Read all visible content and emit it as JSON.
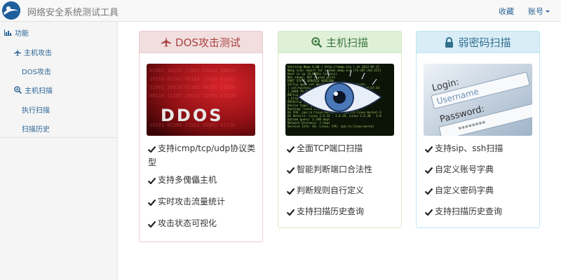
{
  "navbar": {
    "brand_title": "网络安全系统测试工具",
    "favorites": "收藏",
    "account": "账号"
  },
  "sidebar": {
    "header": "功能",
    "items": [
      {
        "label": "主机攻击",
        "icon": "plane-icon"
      },
      {
        "label": "DOS攻击"
      },
      {
        "label": "主机扫描",
        "icon": "zoom-in-icon"
      },
      {
        "label": "执行扫描"
      },
      {
        "label": "扫描历史"
      }
    ]
  },
  "cards": [
    {
      "title": "DOS攻击测试",
      "icon": "plane-icon",
      "image_text": "DDOS",
      "features": [
        "支持icmp/tcp/udp协议类型",
        "支持多傀儡主机",
        "实时攻击流量统计",
        "攻击状态可视化"
      ]
    },
    {
      "title": "主机扫描",
      "icon": "zoom-in-icon",
      "features": [
        "全面TCP端口扫描",
        "智能判断端口合法性",
        "判断规则自行定义",
        "支持扫描历史查询"
      ]
    },
    {
      "title": "弱密码扫描",
      "icon": "lock-icon",
      "image_text": [
        "Login:",
        "Username",
        "Password:",
        "********"
      ],
      "features": [
        "支持sip、ssh扫描",
        "自定义账号字典",
        "自定义密码字典",
        "支持扫描历史查询"
      ]
    }
  ],
  "colors": {
    "link": "#2a6496",
    "danger_bg": "#f2dede",
    "danger_text": "#a94442",
    "success_bg": "#dff0d8",
    "success_text": "#3c763d",
    "info_bg": "#d9edf7",
    "info_text": "#31708f"
  }
}
